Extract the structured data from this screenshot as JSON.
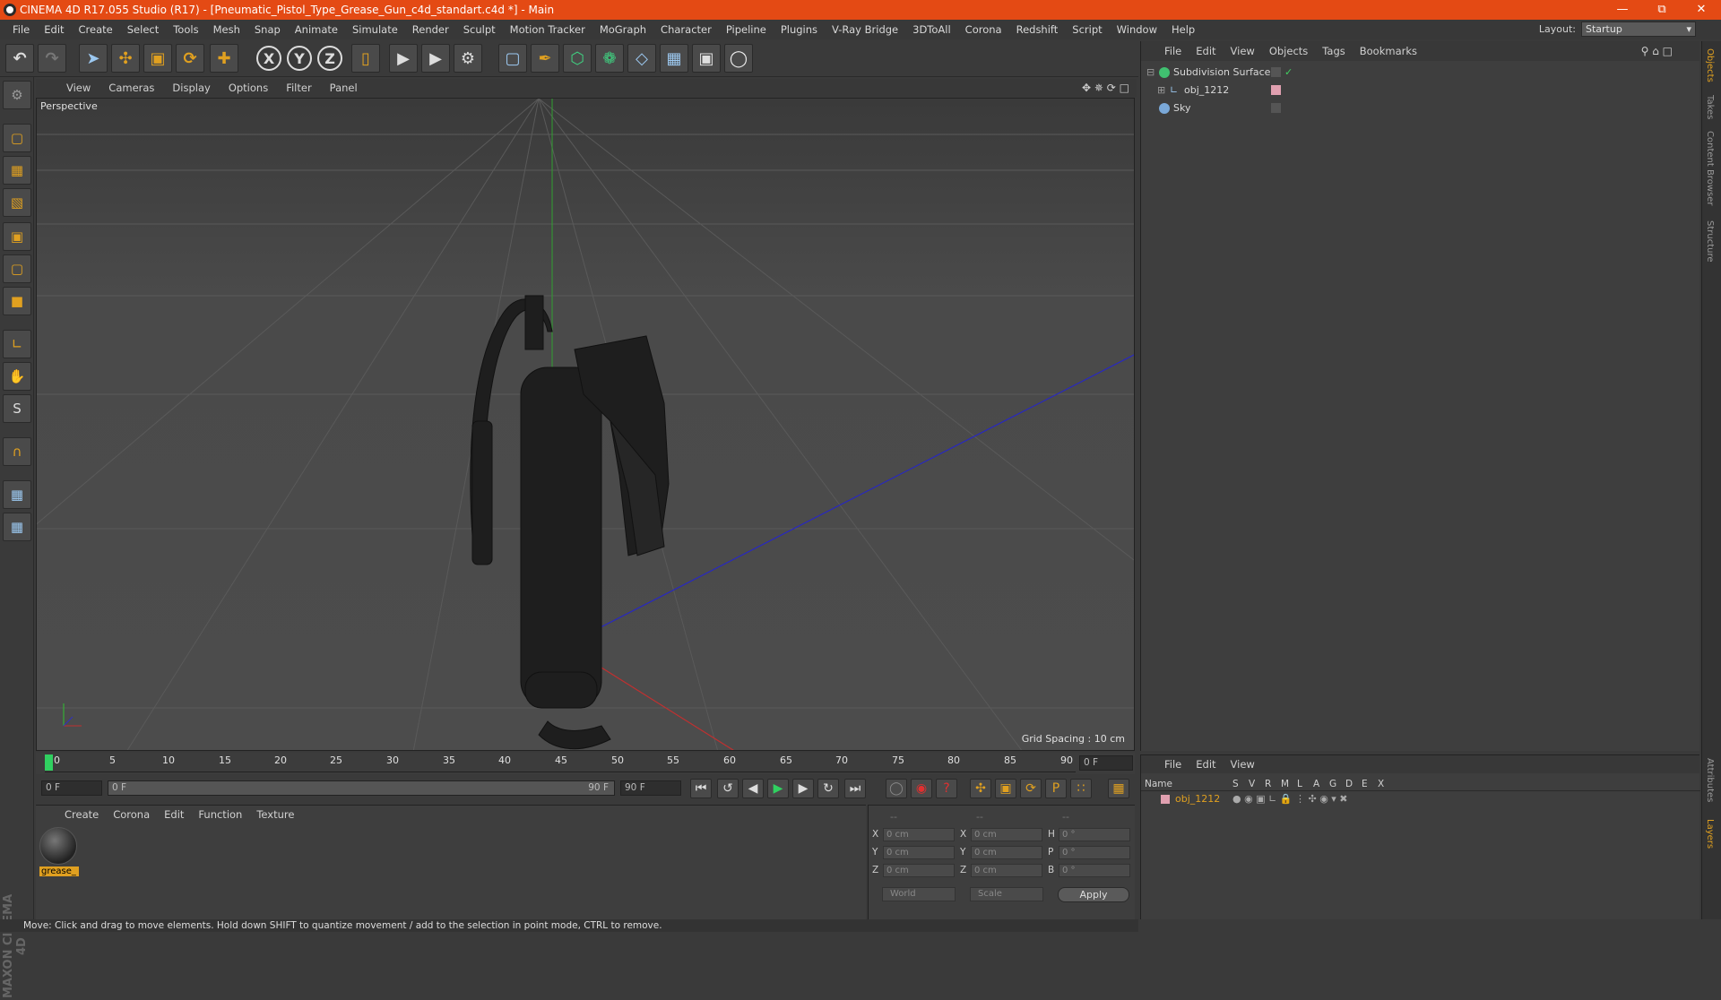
{
  "app": {
    "title": "CINEMA 4D R17.055 Studio (R17) - [Pneumatic_Pistol_Type_Grease_Gun_c4d_standart.c4d *] - Main",
    "accent": "#e44a14"
  },
  "menubar": [
    "File",
    "Edit",
    "Create",
    "Select",
    "Tools",
    "Mesh",
    "Snap",
    "Animate",
    "Simulate",
    "Render",
    "Sculpt",
    "Motion Tracker",
    "MoGraph",
    "Character",
    "Pipeline",
    "Plugins",
    "V-Ray Bridge",
    "3DToAll",
    "Corona",
    "Redshift",
    "Script",
    "Window",
    "Help"
  ],
  "layout": {
    "label": "Layout:",
    "value": "Startup"
  },
  "viewport": {
    "menu": [
      "View",
      "Cameras",
      "Display",
      "Options",
      "Filter",
      "Panel"
    ],
    "camera": "Perspective",
    "grid_spacing": "Grid Spacing : 10 cm"
  },
  "timeline": {
    "ticks": [
      "0",
      "5",
      "10",
      "15",
      "20",
      "25",
      "30",
      "35",
      "40",
      "45",
      "50",
      "55",
      "60",
      "65",
      "70",
      "75",
      "80",
      "85",
      "90"
    ],
    "current_frame": "0 F",
    "start_frame": "0 F",
    "range_start": "0 F",
    "range_end": "90 F",
    "end_frame": "90 F"
  },
  "material": {
    "menu": [
      "Create",
      "Corona",
      "Edit",
      "Function",
      "Texture"
    ],
    "items": [
      {
        "name": "grease_"
      }
    ]
  },
  "coords": {
    "headers": [
      "--",
      "--",
      "--"
    ],
    "rows": [
      {
        "a": "X",
        "av": "0 cm",
        "b": "X",
        "bv": "0 cm",
        "c": "H",
        "cv": "0 °"
      },
      {
        "a": "Y",
        "av": "0 cm",
        "b": "Y",
        "bv": "0 cm",
        "c": "P",
        "cv": "0 °"
      },
      {
        "a": "Z",
        "av": "0 cm",
        "b": "Z",
        "bv": "0 cm",
        "c": "B",
        "cv": "0 °"
      }
    ],
    "mode": "World",
    "type": "Scale",
    "apply": "Apply"
  },
  "objects": {
    "menu": [
      "File",
      "Edit",
      "View",
      "Objects",
      "Tags",
      "Bookmarks"
    ],
    "items": [
      {
        "name": "Subdivision Surface"
      },
      {
        "name": "obj_1212"
      },
      {
        "name": "Sky"
      }
    ]
  },
  "side_tabs": [
    "Objects",
    "Takes",
    "Content Browser",
    "Structure"
  ],
  "side_tabs_bottom": [
    "Attributes",
    "Layers"
  ],
  "layers": {
    "menu": [
      "File",
      "Edit",
      "View"
    ],
    "columns": [
      "Name",
      "S",
      "V",
      "R",
      "M",
      "L",
      "A",
      "G",
      "D",
      "E",
      "X"
    ],
    "items": [
      {
        "name": "obj_1212"
      }
    ]
  },
  "status": "Move: Click and drag to move elements. Hold down SHIFT to quantize movement / add to the selection in point mode, CTRL to remove."
}
